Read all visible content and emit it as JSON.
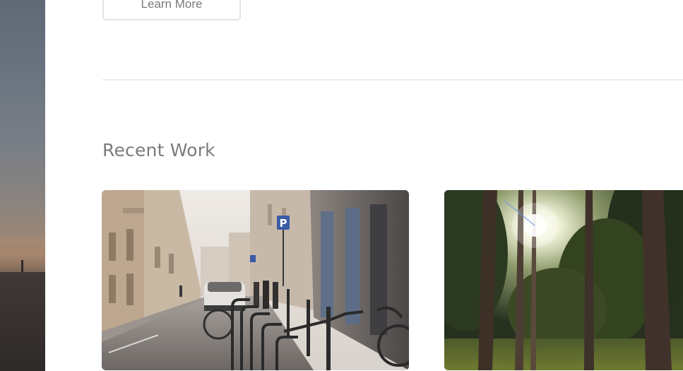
{
  "hero_button": {
    "label": "Learn More"
  },
  "recent_work": {
    "title": "Recent Work",
    "items": [
      {
        "name": "city-street-photo"
      },
      {
        "name": "forest-sunlight-photo"
      }
    ]
  },
  "street_sign": {
    "text": "P"
  }
}
